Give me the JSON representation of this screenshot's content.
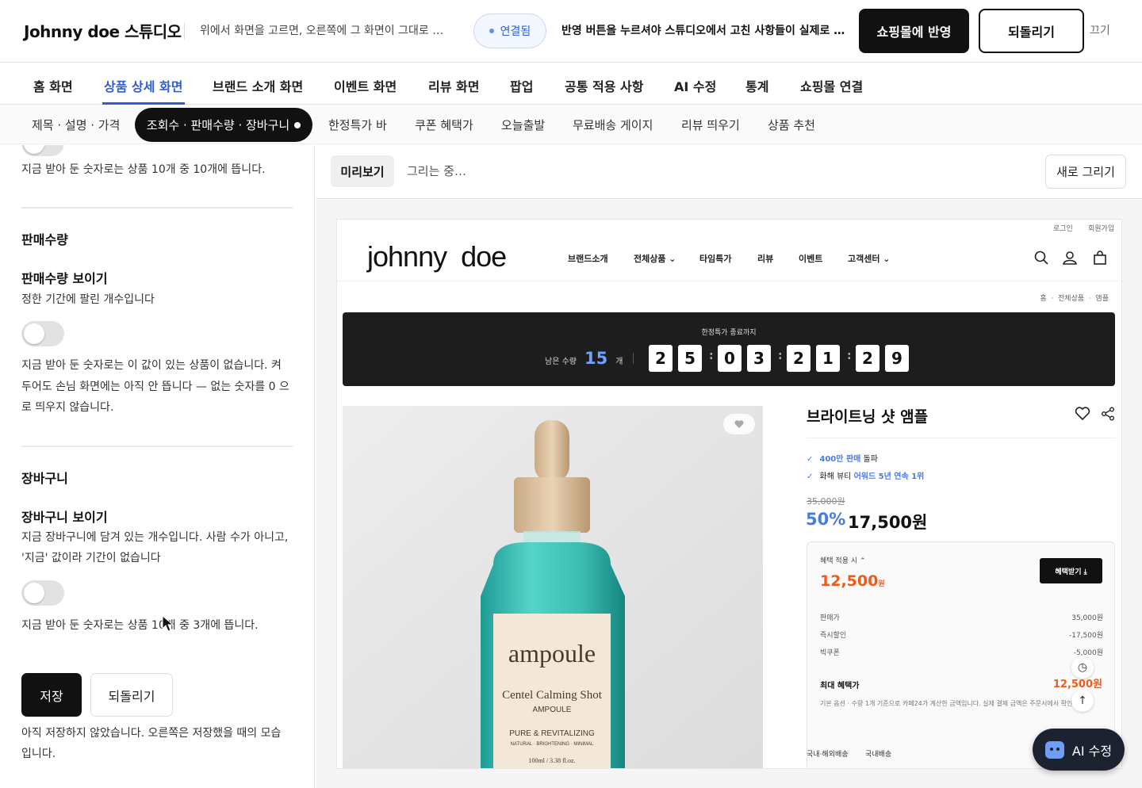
{
  "topbar": {
    "brand": "Johnny doe 스튜디오",
    "hint_left": "위에서 화면을 고르면, 오른쪽에 그 화면이 그대로 …",
    "connection_status": "연결됨",
    "hint_right": "반영 버튼을 누르셔야 스튜디오에서 고친 사항들이 실제로 …",
    "apply_button": "쇼핑몰에 반영",
    "revert_button": "되돌리기",
    "off_button": "끄기"
  },
  "main_nav": {
    "items": [
      "홈 화면",
      "상품 상세 화면",
      "브랜드 소개 화면",
      "이벤트 화면",
      "리뷰 화면",
      "팝업",
      "공통 적용 사항",
      "AI 수정",
      "통계",
      "쇼핑몰 연결"
    ],
    "active_index": 1
  },
  "sub_nav": {
    "items": [
      "제목 · 설명 · 가격",
      "조회수 · 판매수량 · 장바구니",
      "한정특가 바",
      "쿠폰 혜택가",
      "오늘출발",
      "무료배송 게이지",
      "리뷰 띄우기",
      "상품 추천"
    ],
    "active_index": 1
  },
  "left_panel": {
    "views_note": "지금 받아 둔 숫자로는 상품 10개 중 10개에 뜹니다.",
    "sales": {
      "section_title": "판매수량",
      "toggle_label": "판매수량 보이기",
      "toggle_desc": "정한 기간에 팔린 개수입니다",
      "toggle_on": false,
      "note_line1": "지금 받아 둔 숫자로는 이 값이 있는 상품이 없습니다. 켜",
      "note_line2": "두어도 손님 화면에는 아직 안 뜹니다 — 없는 숫자를 0 으",
      "note_line3": "로 띄우지 않습니다."
    },
    "cart": {
      "section_title": "장바구니",
      "toggle_label": "장바구니 보이기",
      "toggle_desc_line1": "지금 장바구니에 담겨 있는 개수입니다. 사람 수가 아니고,",
      "toggle_desc_line2": "'지금' 값이라 기간이 없습니다",
      "toggle_on": false,
      "note": "지금 받아 둔 숫자로는 상품 10개 중 3개에 뜹니다."
    },
    "save_button": "저장",
    "revert_button": "되돌리기",
    "footer_line1": "아직 저장하지 않았습니다. 오른쪽은 저장했을 때의 모습",
    "footer_line2": "입니다."
  },
  "preview_bar": {
    "preview_tab": "미리보기",
    "drawing_status": "그리는 중…",
    "redraw_button": "새로 그리기"
  },
  "shop": {
    "util_login": "로그인",
    "util_join": "회원가입",
    "logo": "johnny  doe",
    "menu": [
      "브랜드소개",
      "전체상품 ⌄",
      "타임특가",
      "리뷰",
      "이벤트",
      "고객센터 ⌄"
    ],
    "icons": [
      "search-icon",
      "user-icon",
      "bag-icon"
    ],
    "breadcrumb": "홈  ·  전체상품  ·  앰플",
    "countdown": {
      "title": "한정특가 종료까지",
      "stock_label": "남은 수량",
      "stock_value": "15",
      "stock_unit": "개",
      "digits": [
        "2",
        "5",
        "0",
        "3",
        "2",
        "1",
        "2",
        "9"
      ]
    },
    "product_image": {
      "label_big": "ampoule",
      "label_sub": "Centel Calming Shot",
      "label_sub2": "AMPOULE",
      "label_line3": "PURE & REVITALIZING",
      "label_line4": "NATURAL · BRIGHTENING · MINIMAL",
      "label_volume": "100ml / 3.38 fl.oz."
    },
    "product": {
      "title": "브라이트닝 샷 앰플",
      "badge1_pre": "400만 판매",
      "badge1_post": "돌파",
      "badge2_pre": "화해 뷰티",
      "badge2_post": "어워드 5년 연속 1위",
      "original_price": "35,000원",
      "discount_pct": "50%",
      "price": "17,500원"
    },
    "benefit": {
      "label": "혜택 적용 시 ⌃",
      "price": "12,500",
      "price_unit": "원",
      "button": "혜택받기 ⤓",
      "rows": [
        {
          "name": "판매가",
          "value": "35,000원"
        },
        {
          "name": "즉시할인",
          "value": "-17,500원"
        },
        {
          "name": "빅쿠폰",
          "value": "-5,000원"
        }
      ],
      "max_label": "최대 혜택가",
      "max_value": "12,500원",
      "note": "기본 옵션 · 수량 1개 기준으로 카페24가 계산한 금액입니다. 실제 결제 금액은 주문서에서 확인됩니다."
    },
    "shipping": [
      "국내·해외배송",
      "국내배송"
    ]
  },
  "ai_button": "AI 수정",
  "colors": {
    "accent_blue": "#2d5fd3",
    "discount_blue": "#4a7be0",
    "benefit_orange": "#f05a1a",
    "dark": "#111111"
  }
}
